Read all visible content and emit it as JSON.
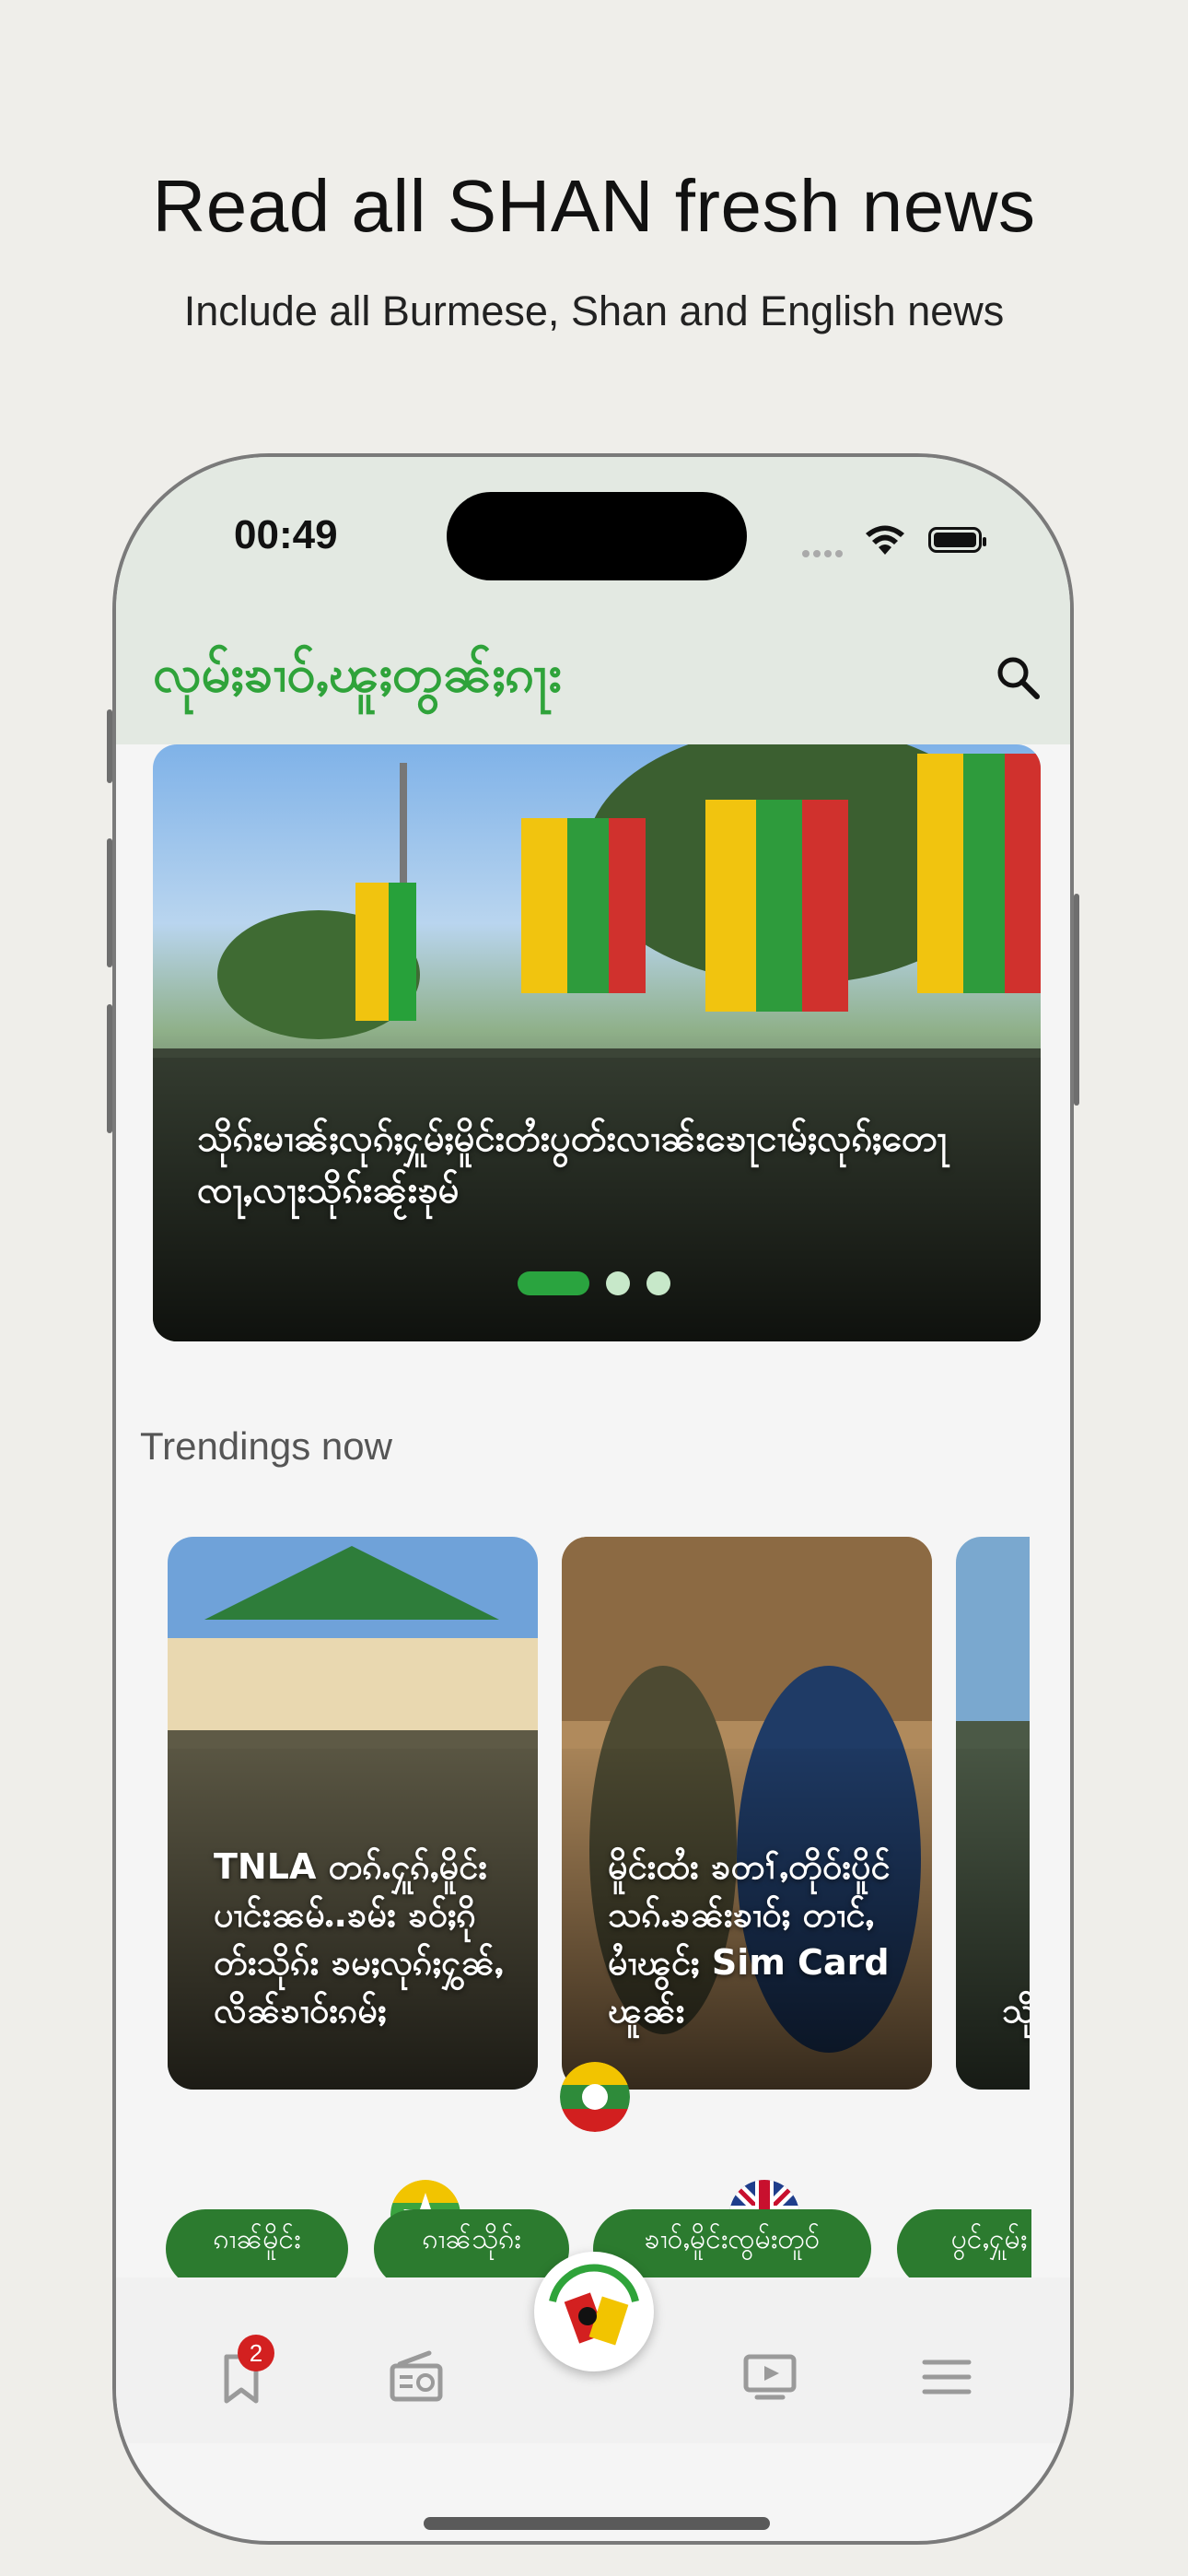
{
  "promo": {
    "headline": "Read all SHAN fresh news",
    "subline": "Include all Burmese, Shan and English news"
  },
  "status_bar": {
    "time": "00:49"
  },
  "app_bar": {
    "brand": "လုမ်ႈၶၢဝ်ႇၽူႈတွၼ်ႈၵႃး",
    "search_icon": "search-icon"
  },
  "hero": {
    "caption": "သိုၵ်းမၢၼ်ႈလုၵ်ႈႁူမ်ႈမိူင်းတႆးပွတ်းလၢၼ်းၶေႃငၢမ်ႈလုၵ်ႈတေႃ ၸႃႇလႃးသိုၵ်းၼႂ်းၶုမ်",
    "pages": 3,
    "active_page": 1
  },
  "trending": {
    "title": "Trendings now",
    "cards": [
      {
        "text": "TNLA တၵ်ႉႁူၵ်ႇမိူင်းပၢင်းၼမ်ႉ.ၶမ်း ၶဝ်ႈၵိုတ်းသိုၵ်း ၶမႈလုၵ်ႈႁွၼ်ႇလိၼ်ၶၢဝ်းၵမ်ႈ"
      },
      {
        "text": "မိူင်းထႆး ၶတၢ်ႇတိုဝ်းပိူင်သၵ်ႉၶၼ်းၶၢဝ်ႈ တၢင်ႇမၢႆၽွင်ႈ Sim Card ၽူၼ်း"
      },
      {
        "text": "သိုၵ်းမၢၼ်ႈ တိူၵ်းၵႂၢမ်း"
      }
    ]
  },
  "categories": [
    {
      "label": "ၵၢၼ်မိူင်း"
    },
    {
      "label": "ၵၢၼ်သိုၵ်း"
    },
    {
      "label": "ၶၢဝ်ႇမိူင်းၸွမ်းတူဝ်"
    },
    {
      "label": "ပွင်ႇႁူမ်ႈ"
    }
  ],
  "bottom_nav": {
    "bookmark_badge": "2",
    "items": [
      "bookmark-icon",
      "radio-icon",
      "app-logo",
      "video-icon",
      "menu-icon"
    ]
  },
  "colors": {
    "accent_green": "#2fa33a",
    "chip_green": "#2c7b2f",
    "badge_red": "#d32020"
  }
}
